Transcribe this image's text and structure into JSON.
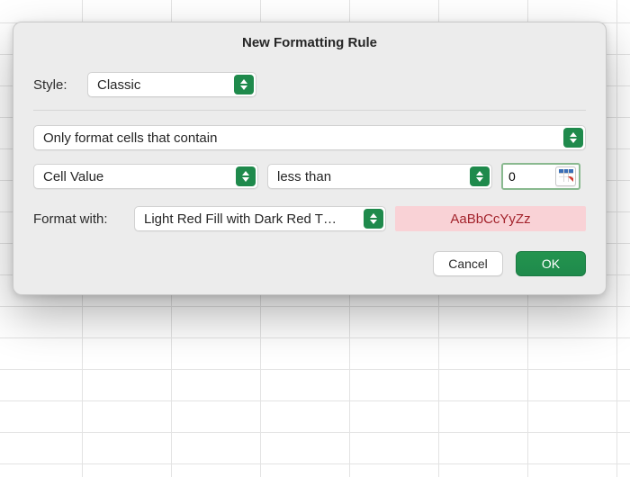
{
  "dialog": {
    "title": "New Formatting Rule",
    "style_label": "Style:",
    "style_value": "Classic",
    "rule_type": "Only format cells that contain",
    "condition": {
      "target": "Cell Value",
      "operator": "less than",
      "value": "0"
    },
    "format_with_label": "Format with:",
    "format_with_value": "Light Red Fill with Dark Red T…",
    "preview_sample": "AaBbCcYyZz",
    "buttons": {
      "cancel": "Cancel",
      "ok": "OK"
    }
  },
  "colors": {
    "accent": "#1f8a4c",
    "preview_fill": "#f9d2d6",
    "preview_text": "#a3232c"
  }
}
